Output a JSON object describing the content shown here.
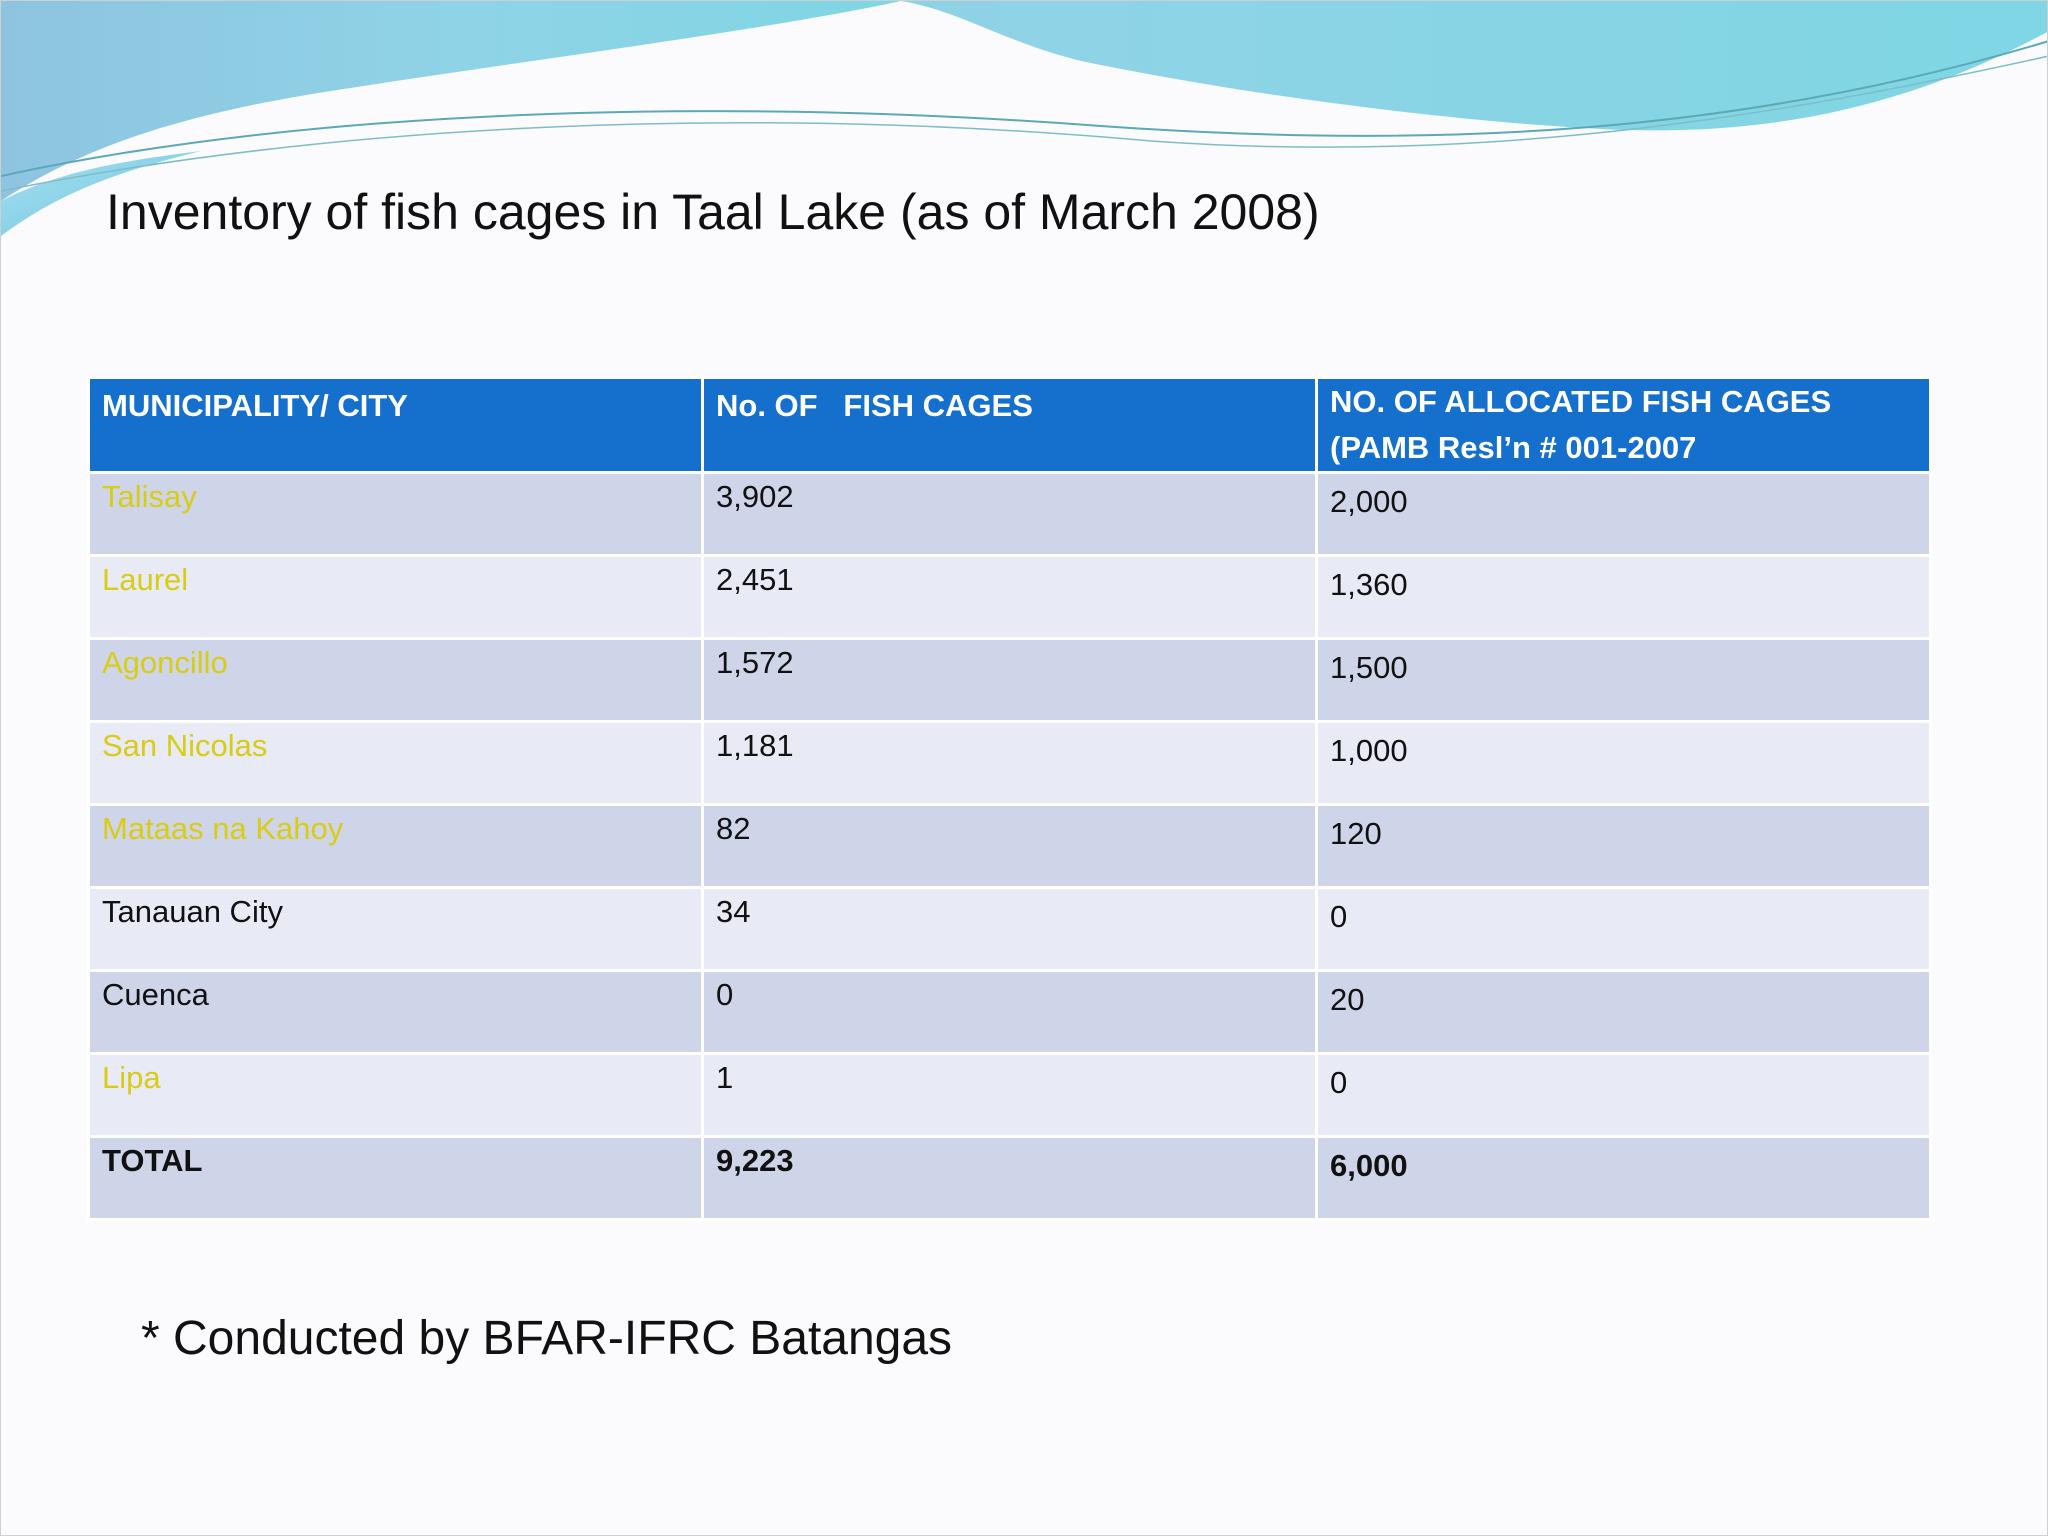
{
  "slide": {
    "title": "Inventory of fish cages in Taal Lake (as of March 2008)",
    "footnote": "* Conducted by BFAR-IFRC Batangas"
  },
  "table": {
    "headers": [
      "MUNICIPALITY/ CITY",
      "No. OF   FISH CAGES",
      "NO. OF ALLOCATED FISH CAGES (PAMB Resl’n # 001-2007"
    ],
    "rows": [
      {
        "municipality": "Talisay",
        "fish_cages": "3,902",
        "allocated": "2,000",
        "highlight": true
      },
      {
        "municipality": "Laurel",
        "fish_cages": "2,451",
        "allocated": "1,360",
        "highlight": true
      },
      {
        "municipality": "Agoncillo",
        "fish_cages": "1,572",
        "allocated": "1,500",
        "highlight": true
      },
      {
        "municipality": "San Nicolas",
        "fish_cages": "1,181",
        "allocated": "1,000",
        "highlight": true
      },
      {
        "municipality": "Mataas na Kahoy",
        "fish_cages": "82",
        "allocated": "120",
        "highlight": true
      },
      {
        "municipality": "Tanauan City",
        "fish_cages": "34",
        "allocated": "0",
        "highlight": false
      },
      {
        "municipality": "Cuenca",
        "fish_cages": "0",
        "allocated": "20",
        "highlight": false
      },
      {
        "municipality": "Lipa",
        "fish_cages": "1",
        "allocated": "0",
        "highlight": true
      }
    ],
    "total": {
      "label": "TOTAL",
      "fish_cages": "9,223",
      "allocated": "6,000"
    }
  },
  "colors": {
    "header_bg": "#1470cc",
    "row_dark": "#cfd5e8",
    "row_light": "#e8ebf5",
    "highlight_text": "#d9cc14",
    "wave_light": "#8fd3e6",
    "wave_dark": "#6ab4d8"
  }
}
